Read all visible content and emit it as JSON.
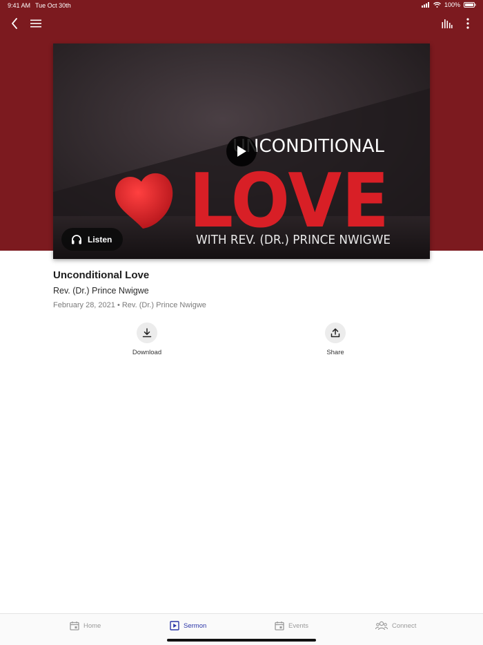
{
  "status_bar": {
    "time": "9:41 AM",
    "date": "Tue Oct 30th",
    "battery": "100%"
  },
  "nav": {
    "back_icon": "chevron-left-icon",
    "menu_icon": "hamburger-menu-icon",
    "audio_icon": "audio-bars-icon",
    "more_icon": "more-vertical-icon"
  },
  "artwork": {
    "line1": "UNCONDITIONAL",
    "line2": "LOVE",
    "line3": "WITH REV. (DR.) PRINCE NWIGWE"
  },
  "player": {
    "listen_label": "Listen",
    "play_icon": "play-icon",
    "headphones_icon": "headphones-icon"
  },
  "sermon": {
    "title": "Unconditional Love",
    "speaker": "Rev. (Dr.) Prince Nwigwe",
    "meta": "February 28, 2021 • Rev. (Dr.) Prince Nwigwe"
  },
  "actions": {
    "download_label": "Download",
    "share_label": "Share"
  },
  "tabs": [
    {
      "label": "Home",
      "icon": "calendar-icon",
      "active": false
    },
    {
      "label": "Sermon",
      "icon": "play-square-icon",
      "active": true
    },
    {
      "label": "Events",
      "icon": "calendar-icon",
      "active": false
    },
    {
      "label": "Connect",
      "icon": "people-icon",
      "active": false
    }
  ],
  "colors": {
    "brand": "#7c1a1f",
    "accent": "#2b35a8",
    "heart": "#d81f26"
  }
}
